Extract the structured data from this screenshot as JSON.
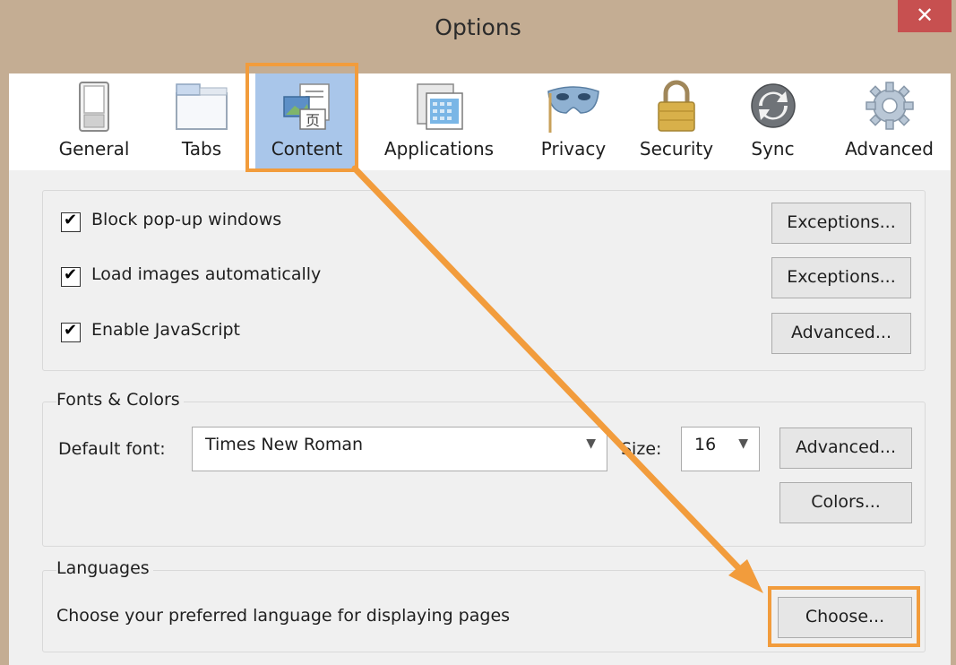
{
  "window": {
    "title": "Options",
    "close_label": "✕"
  },
  "toolbar": {
    "items": [
      {
        "label": "General",
        "icon": "general-switch-icon"
      },
      {
        "label": "Tabs",
        "icon": "tabs-icon"
      },
      {
        "label": "Content",
        "icon": "content-page-icon",
        "selected": true
      },
      {
        "label": "Applications",
        "icon": "applications-icon"
      },
      {
        "label": "Privacy",
        "icon": "privacy-mask-icon"
      },
      {
        "label": "Security",
        "icon": "security-lock-icon"
      },
      {
        "label": "Sync",
        "icon": "sync-icon"
      },
      {
        "label": "Advanced",
        "icon": "advanced-gear-icon"
      }
    ]
  },
  "content": {
    "popups": {
      "label": "Block pop-up windows",
      "checked": true,
      "button": "Exceptions..."
    },
    "images": {
      "label": "Load images automatically",
      "checked": true,
      "button": "Exceptions..."
    },
    "javascript": {
      "label": "Enable JavaScript",
      "checked": true,
      "button": "Advanced..."
    },
    "fonts": {
      "group_label": "Fonts & Colors",
      "default_font_label": "Default font:",
      "default_font_value": "Times New Roman",
      "size_label": "Size:",
      "size_value": "16",
      "advanced_button": "Advanced...",
      "colors_button": "Colors..."
    },
    "languages": {
      "group_label": "Languages",
      "description": "Choose your preferred language for displaying pages",
      "choose_button": "Choose..."
    }
  },
  "annotations": {
    "highlight_color": "#f29c3c"
  }
}
